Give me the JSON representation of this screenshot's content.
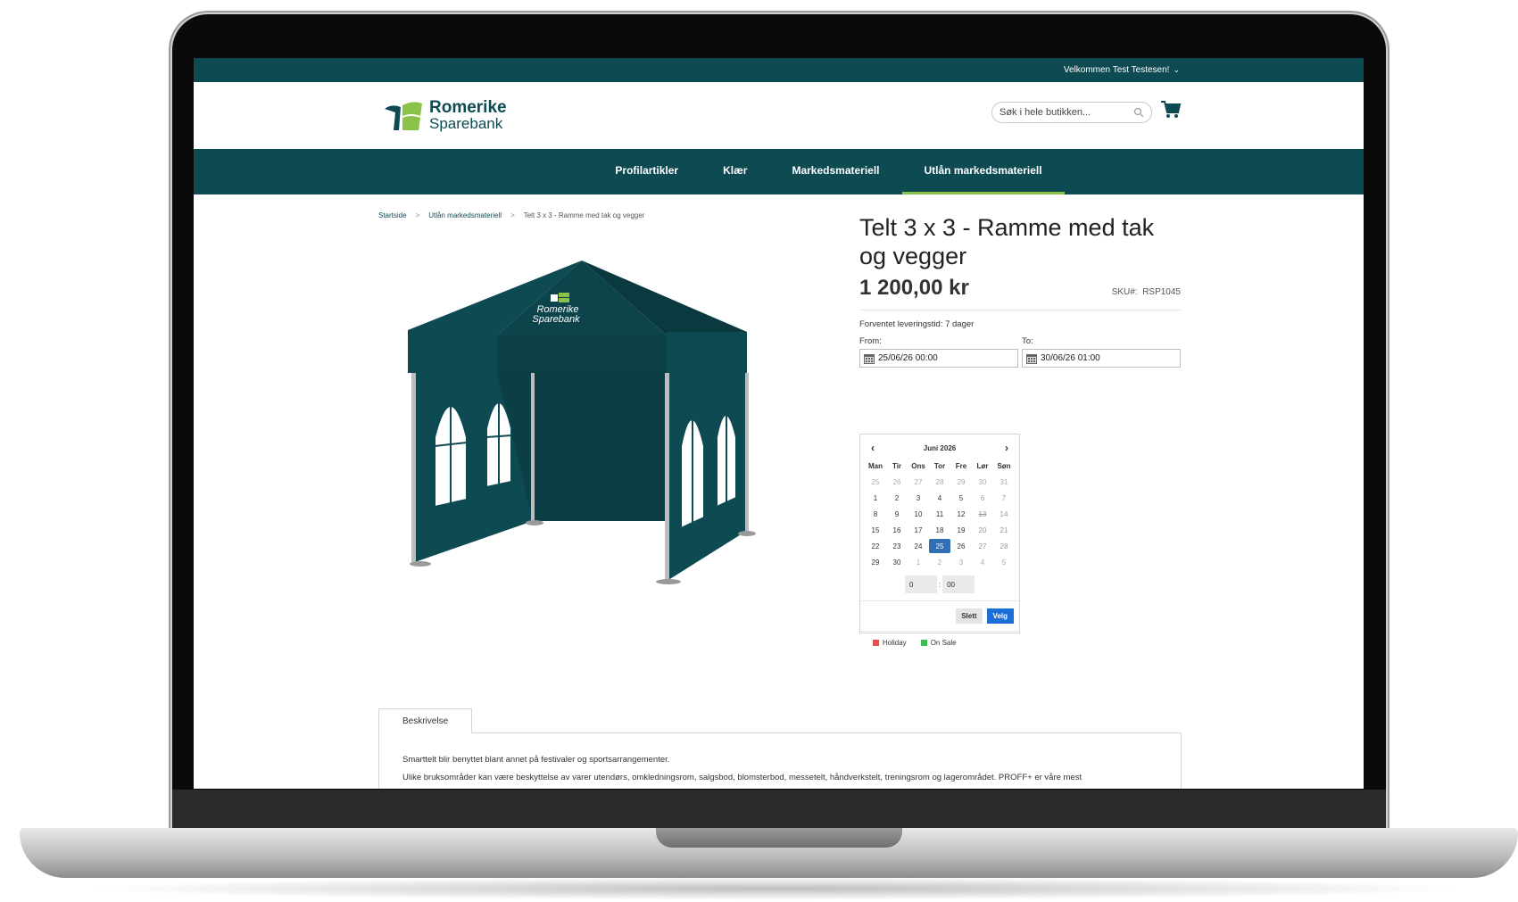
{
  "topbar": {
    "welcome": "Velkommen Test Testesen!",
    "chevron": "⌄"
  },
  "brand": {
    "line1": "Romerike",
    "line2": "Sparebank",
    "color": "#0e4a52",
    "accent": "#8bc34a"
  },
  "search": {
    "placeholder": "Søk i hele butikken..."
  },
  "nav": [
    {
      "label": "Profilartikler"
    },
    {
      "label": "Klær"
    },
    {
      "label": "Markedsmateriell"
    },
    {
      "label": "Utlån markedsmateriell",
      "active": true
    }
  ],
  "breadcrumb": {
    "home": "Startside",
    "category": "Utlån markedsmateriell",
    "current": "Telt 3 x 3 - Ramme med tak og vegger",
    "sep": ">"
  },
  "product": {
    "title": "Telt 3 x 3 - Ramme med tak og vegger",
    "price": "1 200,00 kr",
    "sku_label": "SKU#:",
    "sku": "RSP1045",
    "lead_time": "Forventet leveringstid: 7 dager",
    "image_logo_line1": "Romerike",
    "image_logo_line2": "Sparebank"
  },
  "booking": {
    "from_label": "From:",
    "from_value": "25/06/26 00:00",
    "to_label": "To:",
    "to_value": "30/06/26 01:00"
  },
  "calendar": {
    "month": "Juni 2026",
    "prev": "‹",
    "next": "›",
    "weekdays": [
      "Man",
      "Tir",
      "Ons",
      "Tor",
      "Fre",
      "Lør",
      "Søn"
    ],
    "weeks": [
      [
        "25",
        "26",
        "27",
        "28",
        "29",
        "30",
        "31"
      ],
      [
        "1",
        "2",
        "3",
        "4",
        "5",
        "6",
        "7"
      ],
      [
        "8",
        "9",
        "10",
        "11",
        "12",
        "13",
        "14"
      ],
      [
        "15",
        "16",
        "17",
        "18",
        "19",
        "20",
        "21"
      ],
      [
        "22",
        "23",
        "24",
        "25",
        "26",
        "27",
        "28"
      ],
      [
        "29",
        "30",
        "1",
        "2",
        "3",
        "4",
        "5"
      ]
    ],
    "selected_day": "25",
    "holiday_day": "13",
    "hour": "0",
    "time_sep": ":",
    "minute": "00",
    "clear_label": "Slett",
    "select_label": "Velg",
    "legend_holiday": "Holiday",
    "legend_sale": "On Sale",
    "holiday_color": "#e0524f",
    "sale_color": "#3cba54",
    "selected_color": "#2f6fb5"
  },
  "tabs": {
    "description_tab": "Beskrivelse",
    "line1": "Smarttelt blir benyttet blant annet på festivaler og sportsarrangementer.",
    "line2": "Ulike bruksområder kan være beskyttelse av varer utendørs, omkledningsrom, salgsbod, blomsterbod, messetelt, håndverkstelt, treningsrom og lagerområdet. PROFF+ er våre mest"
  }
}
